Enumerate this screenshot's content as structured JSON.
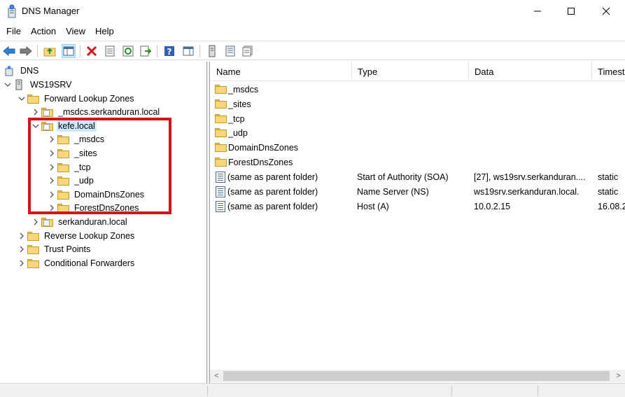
{
  "window": {
    "title": "DNS Manager",
    "controls": {
      "minimize": "—",
      "maximize": "☐",
      "close": "✕"
    }
  },
  "menu": [
    "File",
    "Action",
    "View",
    "Help"
  ],
  "toolbar": {
    "icons": [
      "back-arrow-icon",
      "forward-arrow-icon",
      "up-folder-icon",
      "show-hide-console-tree-icon",
      "delete-icon",
      "properties-icon",
      "refresh-icon",
      "export-list-icon",
      "help-icon",
      "show-action-pane-icon",
      "server-icon",
      "record-list-icon",
      "filter-icon"
    ]
  },
  "tree": {
    "root": "DNS",
    "server": "WS19SRV",
    "forward_zones": "Forward Lookup Zones",
    "zone_msdcs": "_msdcs.serkanduran.local",
    "zone_kefe": "kefe.local",
    "kefe_children": [
      "_msdcs",
      "_sites",
      "_tcp",
      "_udp",
      "DomainDnsZones",
      "ForestDnsZones"
    ],
    "zone_serkanduran": "serkanduran.local",
    "reverse_zones": "Reverse Lookup Zones",
    "trust_points": "Trust Points",
    "conditional_forwarders": "Conditional Forwarders"
  },
  "list": {
    "columns": [
      "Name",
      "Type",
      "Data",
      "Timest"
    ],
    "folders": [
      "_msdcs",
      "_sites",
      "_tcp",
      "_udp",
      "DomainDnsZones",
      "ForestDnsZones"
    ],
    "records": [
      {
        "name": "(same as parent folder)",
        "type": "Start of Authority (SOA)",
        "data": "[27], ws19srv.serkanduran....",
        "timestamp": "static"
      },
      {
        "name": "(same as parent folder)",
        "type": "Name Server (NS)",
        "data": "ws19srv.serkanduran.local.",
        "timestamp": "static"
      },
      {
        "name": "(same as parent folder)",
        "type": "Host (A)",
        "data": "10.0.2.15",
        "timestamp": "16.08.2"
      }
    ]
  },
  "scroll": {
    "left_arrow": "<",
    "right_arrow": ">"
  },
  "colors": {
    "selection": "#cce8ff",
    "highlight_box": "#d3161c",
    "folder": "#f6d77a"
  }
}
